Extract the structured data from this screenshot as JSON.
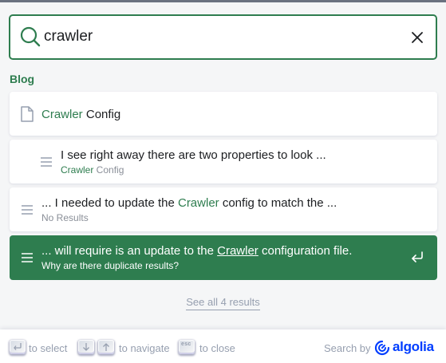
{
  "search": {
    "query": "crawler"
  },
  "section": {
    "title": "Blog"
  },
  "hits": [
    {
      "title_hl": "Crawler",
      "title_rest": " Config",
      "icon": "page-icon"
    },
    {
      "title": "I see right away there are two properties to look ...",
      "path_hl": "Crawler",
      "path_rest": " Config",
      "icon": "paragraph-icon"
    },
    {
      "title_pre": "... I needed to update the ",
      "title_hl": "Crawler",
      "title_post": " config to match the ...",
      "path": "No Results",
      "icon": "paragraph-icon"
    },
    {
      "title_pre": "... will require is an update to the ",
      "title_hl": "Crawler",
      "title_post": " configuration file.",
      "path": "Why are there duplicate results?",
      "icon": "paragraph-icon",
      "selected": true
    }
  ],
  "see_all": "See all 4 results",
  "footer": {
    "select": "to select",
    "navigate": "to navigate",
    "close": "to close",
    "esc_key": "esc",
    "search_by": "Search by",
    "brand": "algolia"
  },
  "colors": {
    "accent": "#2e7d4f",
    "muted": "#969faf",
    "brand": "#003dff"
  }
}
